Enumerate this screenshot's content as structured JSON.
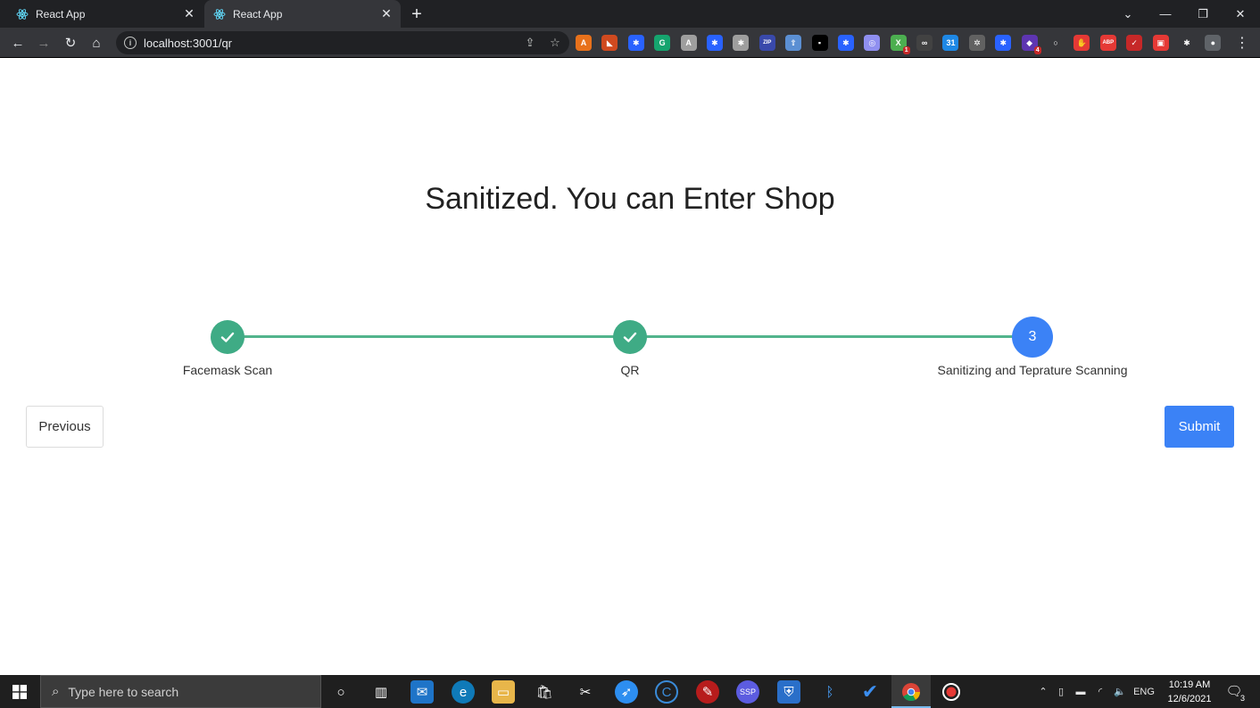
{
  "browser": {
    "tabs": [
      {
        "title": "React App",
        "active": false
      },
      {
        "title": "React App",
        "active": true
      }
    ],
    "url": "localhost:3001/qr",
    "extensions": [
      {
        "name": "avast-icon",
        "color": "#e8711b",
        "glyph": "A"
      },
      {
        "name": "office-icon",
        "color": "#d04a1f",
        "glyph": "◣"
      },
      {
        "name": "puzzle-blue-icon",
        "color": "#2962ff",
        "glyph": "✱"
      },
      {
        "name": "grammarly-icon",
        "color": "#15a46e",
        "glyph": "G"
      },
      {
        "name": "a-circle-icon",
        "color": "#9e9e9e",
        "glyph": "A"
      },
      {
        "name": "puzzle-blue-2-icon",
        "color": "#2962ff",
        "glyph": "✱"
      },
      {
        "name": "puzzle-gray-icon",
        "color": "#9e9e9e",
        "glyph": "✱"
      },
      {
        "name": "zip-icon",
        "color": "#3949ab",
        "glyph": "ZIP"
      },
      {
        "name": "upload-icon",
        "color": "#5b8fd3",
        "glyph": "⇧"
      },
      {
        "name": "notepad-icon",
        "color": "#000000",
        "glyph": "▪"
      },
      {
        "name": "puzzle-blue-3-icon",
        "color": "#2962ff",
        "glyph": "✱"
      },
      {
        "name": "chrome-ext-icon",
        "color": "#8f8ff0",
        "glyph": "◎"
      },
      {
        "name": "x-badge-icon",
        "color": "#4caf50",
        "glyph": "X",
        "badge": "1"
      },
      {
        "name": "glasses-icon",
        "color": "#424242",
        "glyph": "∞"
      },
      {
        "name": "calendar-icon",
        "color": "#1e88e5",
        "glyph": "31"
      },
      {
        "name": "openai-icon",
        "color": "#616161",
        "glyph": "✲"
      },
      {
        "name": "puzzle-blue-4-icon",
        "color": "#2962ff",
        "glyph": "✱"
      },
      {
        "name": "tag-icon",
        "color": "#5e35b1",
        "glyph": "◆",
        "badge": "4"
      },
      {
        "name": "circle-outline-icon",
        "color": "#35363a",
        "glyph": "○"
      },
      {
        "name": "stop-hand-icon",
        "color": "#e53935",
        "glyph": "✋"
      },
      {
        "name": "adblock-icon",
        "color": "#e53935",
        "glyph": "ABP"
      },
      {
        "name": "check-red-icon",
        "color": "#c62828",
        "glyph": "✓"
      },
      {
        "name": "gift-icon",
        "color": "#e53935",
        "glyph": "▣"
      },
      {
        "name": "extensions-puzzle-icon",
        "color": "#35363a",
        "glyph": "✱"
      },
      {
        "name": "profile-icon",
        "color": "#5f6368",
        "glyph": "●"
      }
    ]
  },
  "page": {
    "heading": "Sanitized. You can Enter Shop",
    "steps": [
      {
        "label": "Facemask Scan",
        "status": "completed"
      },
      {
        "label": "QR",
        "status": "completed"
      },
      {
        "label": "Sanitizing and Teprature Scanning",
        "status": "current",
        "number": "3"
      }
    ],
    "buttons": {
      "previous": "Previous",
      "submit": "Submit"
    },
    "colors": {
      "completed": "#3fab85",
      "current": "#3b82f6",
      "connector": "#52b48c"
    }
  },
  "taskbar": {
    "search_placeholder": "Type here to search",
    "apps": [
      "cortana-icon",
      "task-view-icon",
      "mail-icon",
      "edge-icon",
      "file-explorer-icon",
      "store-icon",
      "snip-icon",
      "safari-icon",
      "ccleaner-icon",
      "pen-icon",
      "ssp-icon",
      "shield-icon",
      "bluetooth-icon",
      "todo-icon",
      "chrome-icon",
      "record-icon"
    ],
    "tray": {
      "language": "ENG",
      "time": "10:19 AM",
      "date": "12/6/2021",
      "notifications": "3"
    }
  }
}
